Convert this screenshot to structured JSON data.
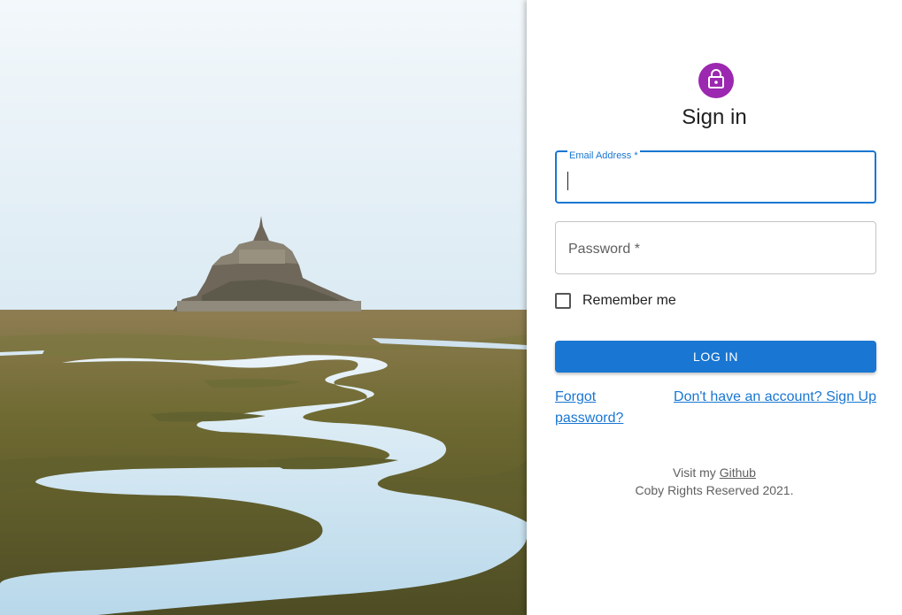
{
  "signin": {
    "title": "Sign in",
    "icon": "lock-icon",
    "avatar_color": "#9c27b0"
  },
  "form": {
    "email_label": "Email Address *",
    "email_value": "",
    "password_placeholder": "Password *",
    "password_value": "",
    "remember_label": "Remember me",
    "remember_checked": false,
    "login_button_label": "LOG IN",
    "accent_color": "#1976d2"
  },
  "links": {
    "forgot_password": "Forgot password?",
    "sign_up": "Don't have an account? Sign Up"
  },
  "footer": {
    "visit_prefix": "Visit my ",
    "github_link": "Github",
    "copyright": "Coby Rights Reserved 2021."
  }
}
